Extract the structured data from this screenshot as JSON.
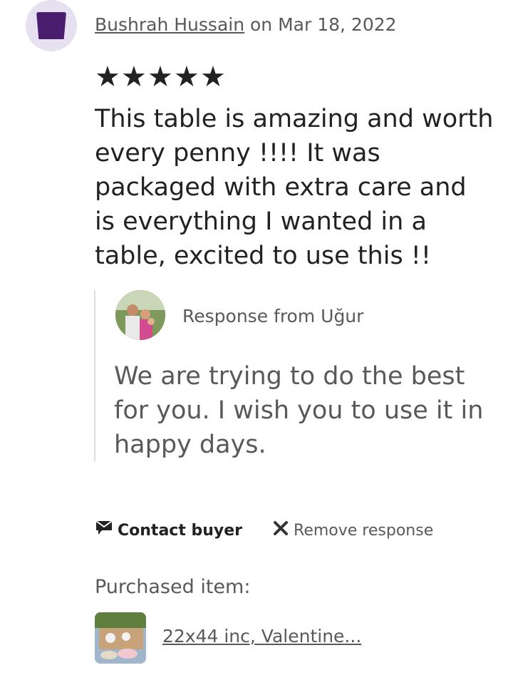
{
  "review": {
    "reviewer_name": "Bushrah Hussain",
    "date_text": " on Mar 18, 2022",
    "rating": 5,
    "star_glyph": "★",
    "text": "This table is amazing and worth every penny !!!! It was packaged with extra care and is everything I wanted in a table, excited to use this !!"
  },
  "response": {
    "from_label": "Response from Uğur",
    "text": "We are trying to do the best for you. I wish you to use it in happy days."
  },
  "actions": {
    "contact_label": "Contact buyer",
    "remove_label": "Remove response"
  },
  "purchase": {
    "label": "Purchased item:",
    "item_title": "22x44 inc, Valentine..."
  },
  "icons": {
    "reviewer_avatar": "square-avatar-icon",
    "contact": "message-flag-icon",
    "remove": "x-close-icon"
  },
  "colors": {
    "text_primary": "#222222",
    "text_secondary": "#595959",
    "avatar_bg": "#e6e0f0",
    "avatar_fill": "#4a1e6e"
  }
}
